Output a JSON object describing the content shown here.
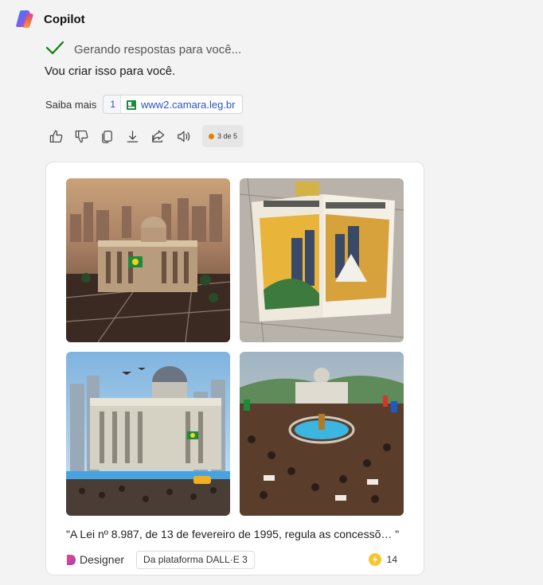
{
  "header": {
    "title": "Copilot",
    "icon": "copilot-logo-icon"
  },
  "status": {
    "text": "Gerando respostas para você...",
    "icon": "checkmark-icon",
    "color": "#107c10"
  },
  "reply": {
    "text": "Vou criar isso para você."
  },
  "learn_more": {
    "label": "Saiba mais",
    "sources": [
      {
        "number": "1",
        "url": "www2.camara.leg.br",
        "icon": "favicon-camara-icon"
      }
    ]
  },
  "actions": {
    "items": [
      {
        "name": "like",
        "icon": "thumbs-up-icon"
      },
      {
        "name": "dislike",
        "icon": "thumbs-down-icon"
      },
      {
        "name": "copy",
        "icon": "copy-icon"
      },
      {
        "name": "download",
        "icon": "download-icon"
      },
      {
        "name": "share",
        "icon": "share-icon"
      },
      {
        "name": "read-aloud",
        "icon": "speaker-icon"
      }
    ],
    "page_indicator": "3 de 5"
  },
  "image_card": {
    "images": [
      {
        "name": "generated-image-1",
        "description_icon": "image"
      },
      {
        "name": "generated-image-2",
        "description_icon": "image"
      },
      {
        "name": "generated-image-3",
        "description_icon": "image"
      },
      {
        "name": "generated-image-4",
        "description_icon": "image"
      }
    ],
    "caption": "\"A Lei nº 8.987, de 13 de fevereiro de 1995, regula as concessõ…  \"",
    "designer_label": "Designer",
    "platform_label": "Da plataforma DALL·E 3",
    "boost_count": "14"
  },
  "colors": {
    "accent_link": "#2b53c4",
    "badge_dot": "#e67e00",
    "boost": "#f7c62f"
  }
}
